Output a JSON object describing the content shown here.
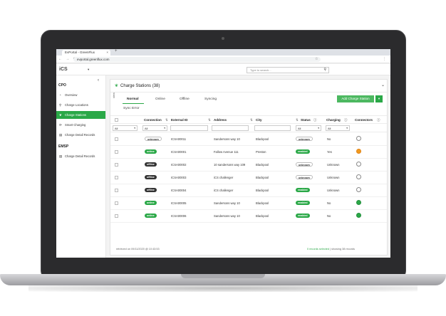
{
  "browser": {
    "tab_title": "EvPortal - GreenFlux",
    "tab_close": "×",
    "new_tab": "+",
    "nav": "← → ⟳",
    "url": "evportal.greenflux.com",
    "star": "☆",
    "menu": "⋮"
  },
  "header": {
    "logo": "iCS",
    "logo_caret": "▾",
    "search_placeholder": "Type to search..."
  },
  "sidebar": {
    "collapse": "‹",
    "sections": [
      {
        "title": "CPO",
        "items": [
          {
            "label": "Overview",
            "icon": "gauge-icon",
            "glyph": "◔"
          },
          {
            "label": "Charge Locations",
            "icon": "location-pin-icon",
            "glyph": "⚲"
          },
          {
            "label": "Charge Stations",
            "icon": "leaf-icon",
            "glyph": "❦",
            "active": true
          },
          {
            "label": "Smart Charging",
            "icon": "smart-charging-icon",
            "glyph": "⟳"
          },
          {
            "label": "Charge Detail Records",
            "icon": "records-icon",
            "glyph": "▤"
          }
        ]
      },
      {
        "title": "EMSP",
        "items": [
          {
            "label": "Charge Detail Records",
            "icon": "records-icon",
            "glyph": "▤"
          }
        ]
      }
    ]
  },
  "main": {
    "title": "Charge Stations (38)",
    "title_icon": "❦",
    "chevron": "⌄",
    "view_label": "view",
    "tabs": [
      "Normal",
      "Online",
      "Offline",
      "Syncing"
    ],
    "tab_second_row": "Sync Error",
    "add_button": "Add Charge Station",
    "add_caret": "▾"
  },
  "table": {
    "columns": [
      "Connection",
      "External ID",
      "Address",
      "City",
      "Status",
      "Charging",
      "Connectors"
    ],
    "column_icons": [
      "",
      "⇅",
      "⇅",
      "⇅",
      "ⓘ",
      "ⓘ",
      "ⓘ"
    ],
    "filters": {
      "connection": "All",
      "status": "All",
      "charging": "All",
      "first": "All"
    },
    "rows": [
      {
        "connection": "unknown",
        "external_id": "ICSA00011",
        "address": "Sandersons way 10",
        "city": "Blackpool",
        "status": "unknown",
        "charging": "No",
        "connector": "grey"
      },
      {
        "connection": "online",
        "external_id": "ICSA00001",
        "address": "Fallow Avenue 111",
        "city": "Preston",
        "status": "enabled",
        "charging": "Yes",
        "connector": "orange"
      },
      {
        "connection": "offline",
        "external_id": "ICSA00002",
        "address": "10 sandersons way 109",
        "city": "Blackpool",
        "status": "unknown",
        "charging": "Unknown",
        "connector": "grey"
      },
      {
        "connection": "offline",
        "external_id": "ICSA00003",
        "address": "iCS challenger",
        "city": "Blackpool",
        "status": "unknown",
        "charging": "Unknown",
        "connector": "grey"
      },
      {
        "connection": "offline",
        "external_id": "ICSA00004",
        "address": "iCS challenger",
        "city": "Blackpool",
        "status": "enabled",
        "charging": "Unknown",
        "connector": "grey"
      },
      {
        "connection": "online",
        "external_id": "ICSA00005",
        "address": "Sandersons way 10",
        "city": "Blackpool",
        "status": "enabled",
        "charging": "No",
        "connector": "green"
      },
      {
        "connection": "online",
        "external_id": "ICSA00006",
        "address": "Sandersons way 10",
        "city": "Blackpool",
        "status": "enabled",
        "charging": "No",
        "connector": "green"
      }
    ],
    "footer_left": "retrieved on 09/11/2020 @ 10:43:53",
    "footer_selected": "0 records selected",
    "footer_showing": " | showing 38 records"
  },
  "colors": {
    "accent": "#2aa847",
    "orange": "#f29a1d",
    "dark_badge": "#333333"
  }
}
